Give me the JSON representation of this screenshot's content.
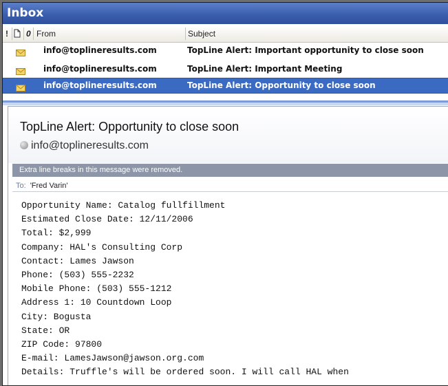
{
  "inbox": {
    "title": "Inbox",
    "columns": {
      "importance": "!",
      "attachment": "0",
      "from": "From",
      "subject": "Subject"
    },
    "messages": [
      {
        "from": "info@toplineresults.com",
        "subject": "TopLine Alert: Important opportunity to close soon",
        "selected": false
      },
      {
        "from": "info@toplineresults.com",
        "subject": "TopLine Alert: Important Meeting",
        "selected": false
      },
      {
        "from": "info@toplineresults.com",
        "subject": "TopLine Alert: Opportunity to close soon",
        "selected": true
      }
    ]
  },
  "reading_pane": {
    "title": "TopLine Alert:  Opportunity to close soon",
    "sender": "info@toplineresults.com",
    "infobar": "Extra line breaks in this message were removed.",
    "to_label": "To:",
    "to_value": "'Fred Varin'",
    "body_lines": [
      "Opportunity Name: Catalog fullfillment",
      "Estimated Close Date: 12/11/2006",
      "Total: $2,999",
      "Company: HAL's Consulting Corp",
      "Contact: Lames Jawson",
      "Phone: (503) 555-2232",
      "Mobile Phone: (503) 555-1212",
      "Address 1: 10 Countdown Loop",
      "City: Bogusta",
      "State: OR",
      "ZIP Code: 97800",
      "E-mail: LamesJawson@jawson.org.com",
      "Details: Truffle's will be ordered soon. I will call HAL when"
    ]
  },
  "colors": {
    "selection": "#3b6ac3",
    "header_bar": "#3b5fad",
    "infobar": "#8d96a8"
  }
}
